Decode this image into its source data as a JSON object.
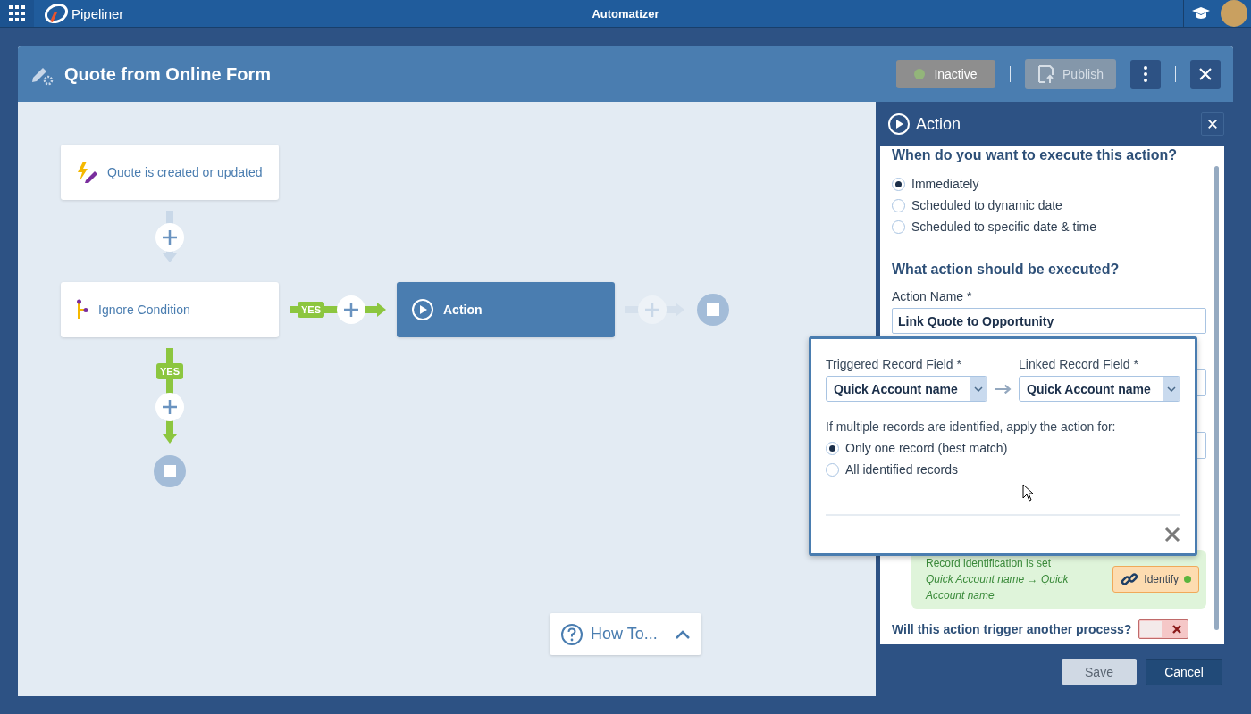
{
  "top_bar": {
    "brand": "Pipeliner",
    "title": "Automatizer"
  },
  "editor": {
    "title": "Quote from Online Form",
    "status_button": {
      "label": "Inactive",
      "active": false
    },
    "publish_button": {
      "label": "Publish",
      "disabled": true
    }
  },
  "canvas": {
    "nodes": [
      {
        "kind": "trigger",
        "label": "Quote is created or updated",
        "selected": false
      },
      {
        "kind": "condition",
        "label": "Ignore Condition",
        "selected": false
      },
      {
        "kind": "action",
        "label": "Action",
        "selected": true
      }
    ],
    "branch_labels": [
      "YES",
      "YES"
    ],
    "how_to": "How To..."
  },
  "action_panel": {
    "title": "Action",
    "timing_question": "When do you want to execute this action?",
    "timing_options": [
      {
        "label": "Immediately",
        "selected": true
      },
      {
        "label": "Scheduled to dynamic date",
        "selected": false
      },
      {
        "label": "Scheduled to specific date & time",
        "selected": false
      }
    ],
    "action_question": "What action should be executed?",
    "action_name_label": "Action Name *",
    "action_name": "Link Quote to Opportunity",
    "identification": {
      "set": true,
      "status": "Record identification is set",
      "mapping": "Quick Account name → Quick Account name",
      "button": "Identify"
    },
    "trigger_question": "Will this action trigger another process?",
    "trigger_toggle": {
      "on": false
    },
    "buttons": {
      "save": "Save",
      "cancel": "Cancel"
    }
  },
  "identify_popup": {
    "triggered_label": "Triggered Record Field *",
    "triggered_value": "Quick Account name",
    "linked_label": "Linked Record Field *",
    "linked_value": "Quick Account name",
    "multiple_question": "If multiple records are identified, apply the action for:",
    "options": [
      {
        "label": "Only one record (best match)",
        "selected": true
      },
      {
        "label": "All identified records",
        "selected": false
      }
    ]
  }
}
